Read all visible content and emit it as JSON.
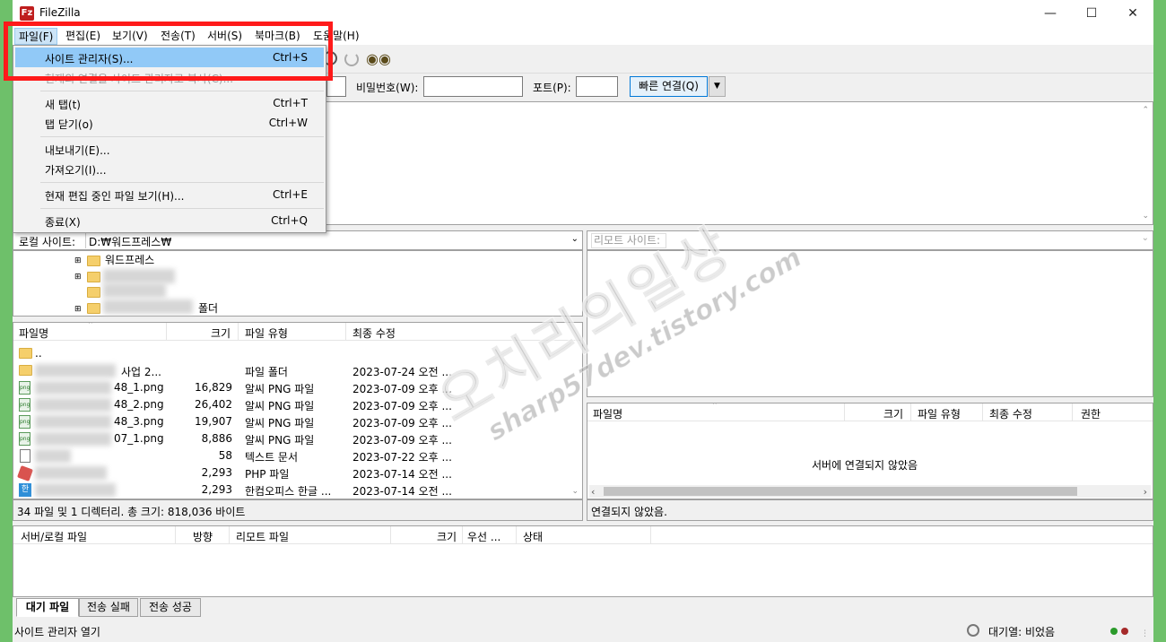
{
  "window": {
    "title": "FileZilla"
  },
  "menubar": {
    "file": "파일(F)",
    "edit": "편집(E)",
    "view": "보기(V)",
    "transfer": "전송(T)",
    "server": "서버(S)",
    "bookmarks": "북마크(B)",
    "help": "도움말(H)"
  },
  "file_menu": {
    "site_manager": {
      "label": "사이트 관리자(S)...",
      "shortcut": "Ctrl+S"
    },
    "copy_connection": {
      "label": "현재의 연결을 사이트 관리자로 복사(C)..."
    },
    "new_tab": {
      "label": "새 탭(t)",
      "shortcut": "Ctrl+T"
    },
    "close_tab": {
      "label": "탭 닫기(o)",
      "shortcut": "Ctrl+W"
    },
    "export": {
      "label": "내보내기(E)..."
    },
    "import": {
      "label": "가져오기(I)..."
    },
    "show_edited": {
      "label": "현재 편집 중인 파일 보기(H)...",
      "shortcut": "Ctrl+E"
    },
    "exit": {
      "label": "종료(X)",
      "shortcut": "Ctrl+Q"
    }
  },
  "quickconnect": {
    "password_label": "비밀번호(W):",
    "port_label": "포트(P):",
    "button": "빠른 연결(Q)",
    "password_value": "",
    "port_value": ""
  },
  "local": {
    "site_label": "로컬 사이트:",
    "path": "D:₩워드프레스₩",
    "tree": [
      {
        "label": "워드프레스"
      },
      {
        "label": ""
      },
      {
        "label": ""
      },
      {
        "label": "폴더"
      }
    ],
    "columns": {
      "name": "파일명",
      "size": "크기",
      "type": "파일 유형",
      "modified": "최종 수정"
    },
    "files": [
      {
        "name": "..",
        "size": "",
        "type": "",
        "modified": "",
        "icon": "folder-icon"
      },
      {
        "name": "사업 2...",
        "size": "",
        "type": "파일 폴더",
        "modified": "2023-07-24 오전 ...",
        "icon": "folder-icon"
      },
      {
        "name": "48_1.png",
        "size": "16,829",
        "type": "알씨 PNG 파일",
        "modified": "2023-07-09 오후 ...",
        "icon": "png-icon"
      },
      {
        "name": "48_2.png",
        "size": "26,402",
        "type": "알씨 PNG 파일",
        "modified": "2023-07-09 오후 ...",
        "icon": "png-icon"
      },
      {
        "name": "48_3.png",
        "size": "19,907",
        "type": "알씨 PNG 파일",
        "modified": "2023-07-09 오후 ...",
        "icon": "png-icon"
      },
      {
        "name": "07_1.png",
        "size": "8,886",
        "type": "알씨 PNG 파일",
        "modified": "2023-07-09 오후 ...",
        "icon": "png-icon"
      },
      {
        "name": "",
        "size": "58",
        "type": "텍스트 문서",
        "modified": "2023-07-22 오후 ...",
        "icon": "txt-icon"
      },
      {
        "name": "",
        "size": "2,293",
        "type": "PHP 파일",
        "modified": "2023-07-14 오전 ...",
        "icon": "php-icon"
      },
      {
        "name": "",
        "size": "2,293",
        "type": "한컴오피스 한글 ...",
        "modified": "2023-07-14 오전 ...",
        "icon": "hwp-icon"
      }
    ],
    "status": "34 파일 및 1 디렉터리. 총 크기: 818,036 바이트"
  },
  "remote": {
    "site_label": "리모트 사이트:",
    "columns": {
      "name": "파일명",
      "size": "크기",
      "type": "파일 유형",
      "modified": "최종 수정",
      "perms": "권한"
    },
    "empty_message": "서버에 연결되지 않았음",
    "status": "연결되지 않았음."
  },
  "queue": {
    "columns": {
      "server_file": "서버/로컬 파일",
      "direction": "방향",
      "remote_file": "리모트 파일",
      "size": "크기",
      "priority": "우선 ...",
      "status": "상태"
    },
    "tabs": {
      "queued": "대기 파일",
      "failed": "전송 실패",
      "successful": "전송 성공"
    }
  },
  "statusbar": {
    "message": "사이트 관리자 열기",
    "queue": "대기열: 비었음"
  },
  "watermark": {
    "main": "오치리의일상",
    "url": "sharp57dev.tistory.com"
  },
  "colors": {
    "highlight": "#ff1a1a",
    "menu_selected": "#91c9f7",
    "desktop": "#6ec06a"
  }
}
